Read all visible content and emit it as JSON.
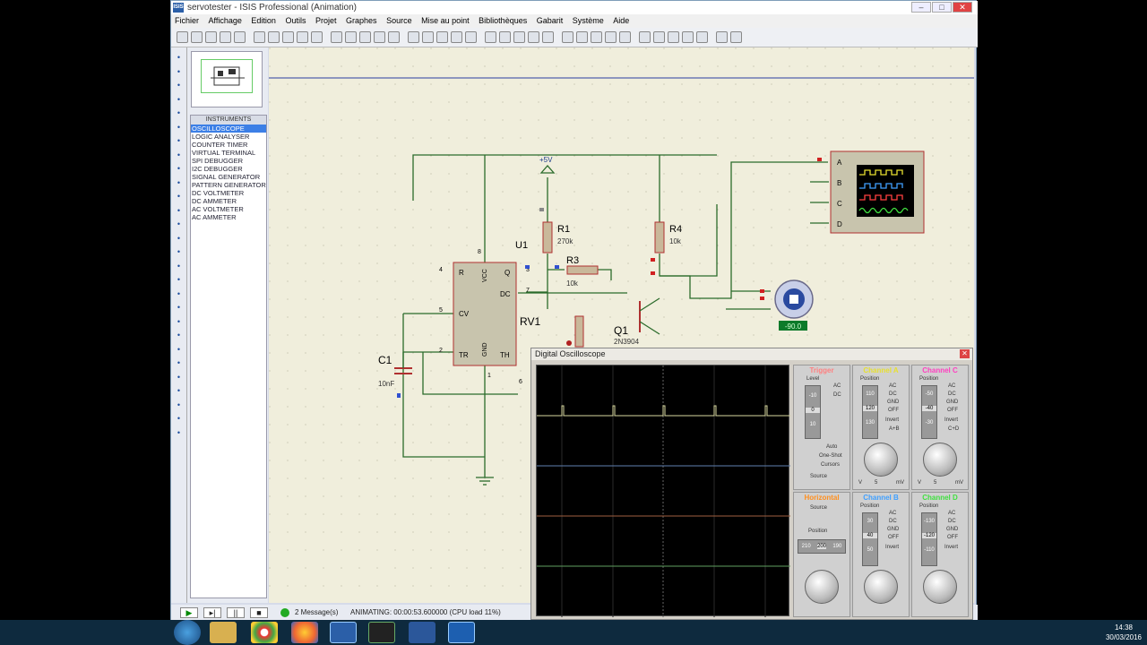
{
  "window": {
    "title": "servotester - ISIS Professional (Animation)",
    "app_icon": "ISIS"
  },
  "menu": [
    "Fichier",
    "Affichage",
    "Edition",
    "Outils",
    "Projet",
    "Graphes",
    "Source",
    "Mise au point",
    "Bibliothèques",
    "Gabarit",
    "Système",
    "Aide"
  ],
  "instruments": {
    "header": "INSTRUMENTS",
    "items": [
      "OSCILLOSCOPE",
      "LOGIC ANALYSER",
      "COUNTER TIMER",
      "VIRTUAL TERMINAL",
      "SPI DEBUGGER",
      "I2C DEBUGGER",
      "SIGNAL GENERATOR",
      "PATTERN GENERATOR",
      "DC VOLTMETER",
      "DC AMMETER",
      "AC VOLTMETER",
      "AC AMMETER"
    ],
    "selected_index": 0
  },
  "schematic": {
    "supply": "+5V",
    "r1": {
      "name": "R1",
      "value": "270k"
    },
    "r4": {
      "name": "R4",
      "value": "10k"
    },
    "r3": {
      "name": "R3",
      "value": "10k"
    },
    "u1": "U1",
    "rv1": "RV1",
    "c1": {
      "name": "C1",
      "value": "10nF"
    },
    "q1": {
      "name": "Q1",
      "part": "2N3904"
    },
    "pins": {
      "r": "R",
      "vcc": "VCC",
      "q": "Q",
      "dc": "DC",
      "cv": "CV",
      "tr": "TR",
      "gnd": "GND",
      "th": "TH",
      "p4": "4",
      "p8": "8",
      "p3": "3",
      "p7": "7",
      "p5": "5",
      "p2": "2",
      "p6": "6",
      "p1": "1"
    },
    "scope_inputs": [
      "A",
      "B",
      "C",
      "D"
    ],
    "servo_angle": "-90.0"
  },
  "status": {
    "messages": "2 Message(s)",
    "animating": "ANIMATING: 00:00:53.600000 (CPU load 11%)"
  },
  "oscilloscope": {
    "title": "Digital Oscilloscope",
    "trigger_title": "Trigger",
    "channels": {
      "a": {
        "title": "Channel A",
        "pos": [
          "110",
          "120",
          "130"
        ],
        "color": "#e8e030"
      },
      "b": {
        "title": "Channel B",
        "pos": [
          "30",
          "40",
          "50"
        ],
        "color": "#40a0ff"
      },
      "c": {
        "title": "Channel C",
        "pos": [
          "-50",
          "-40",
          "-30"
        ],
        "color": "#ff40c0"
      },
      "d": {
        "title": "Channel D",
        "pos": [
          "-130",
          "-120",
          "-110"
        ],
        "color": "#40e040"
      }
    },
    "horizontal_title": "Horizontal",
    "labels": {
      "level": "Level",
      "ac": "AC",
      "dc": "DC",
      "gnd": "GND",
      "off": "OFF",
      "invert": "Invert",
      "apb": "A+B",
      "cpd": "C+D",
      "position": "Position",
      "source": "Source",
      "auto": "Auto",
      "oneshot": "One-Shot",
      "cursors": "Cursors",
      "v": "V",
      "mv": "mV",
      "five": "5"
    },
    "trigger_levels": [
      "-10",
      "0",
      "10"
    ],
    "horizontal_pos": [
      "210",
      "200",
      "190"
    ],
    "trigger_color": "#ff8080",
    "horizontal_color": "#ff9020"
  },
  "clock": {
    "time": "14:38",
    "date": "30/03/2016"
  }
}
